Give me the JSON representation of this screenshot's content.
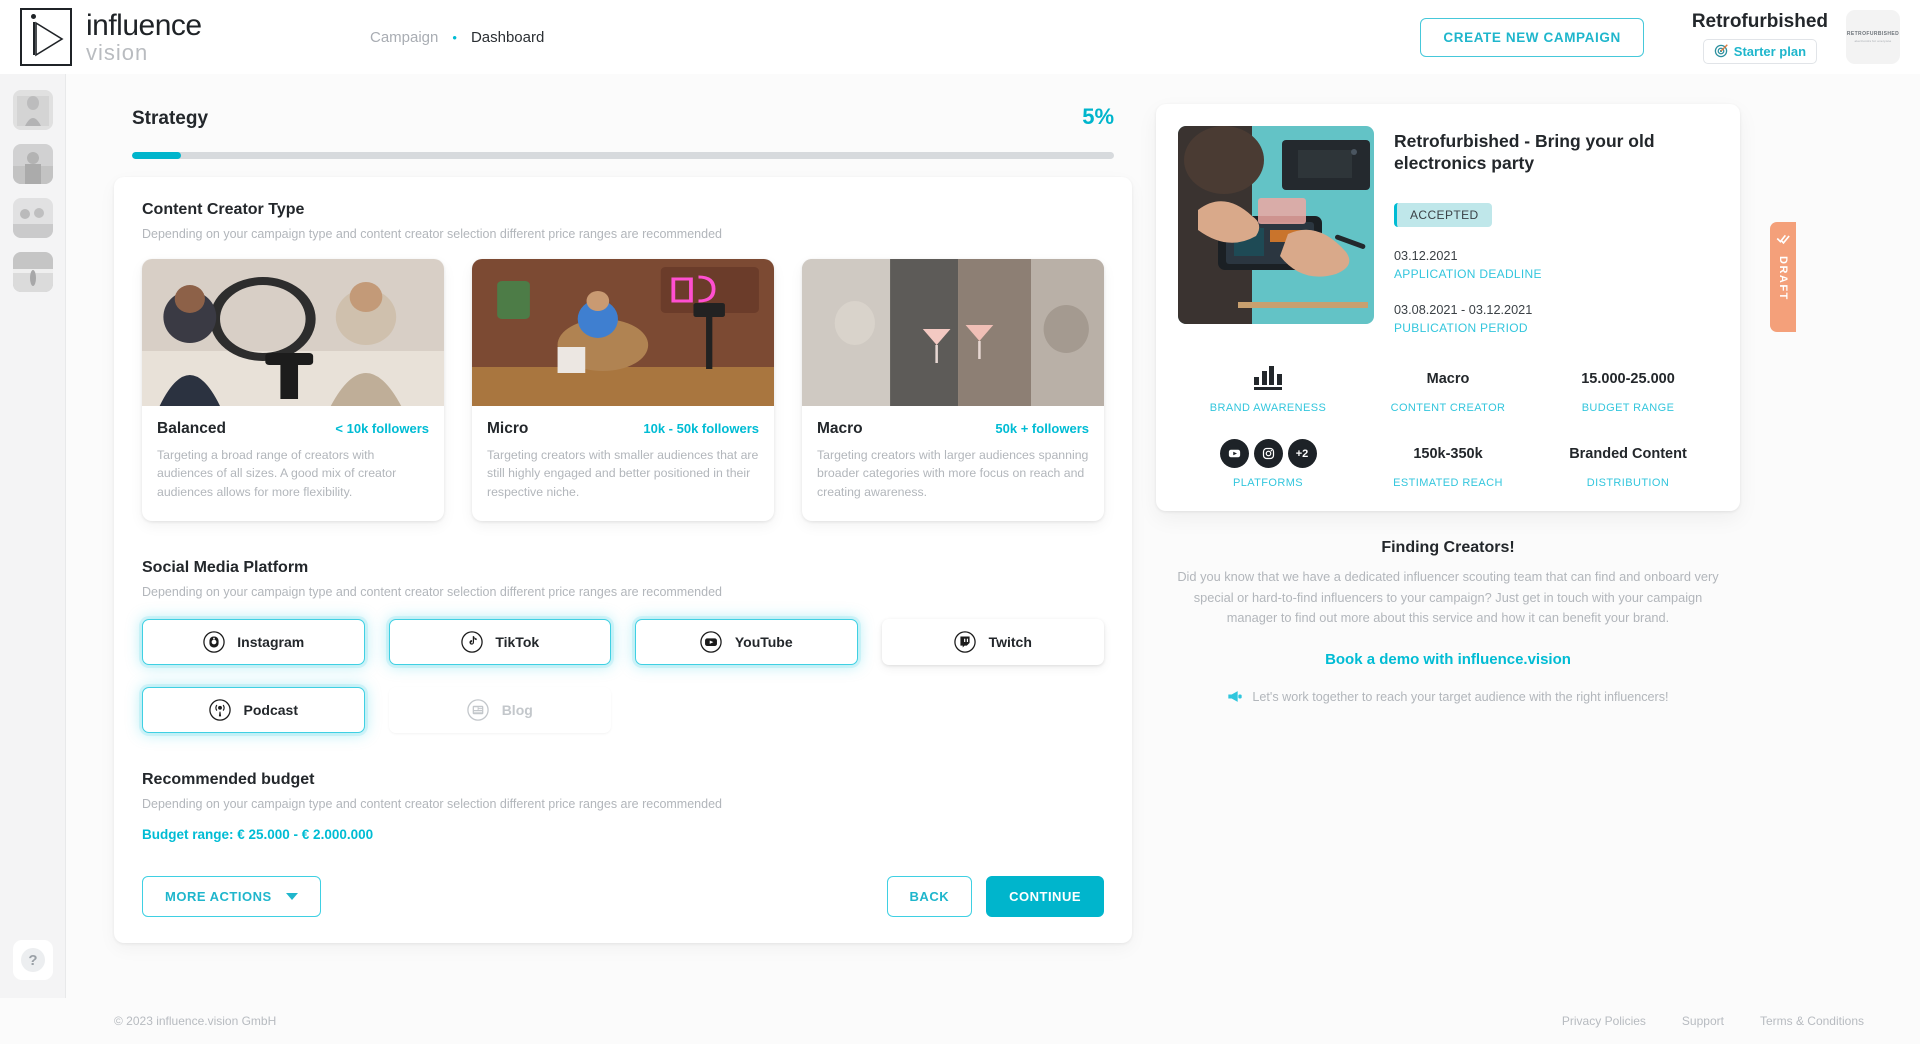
{
  "brand": {
    "line1": "influence",
    "line2": "vision"
  },
  "breadcrumb": {
    "parent": "Campaign",
    "separator": "•",
    "current": "Dashboard"
  },
  "header": {
    "create_button": "CREATE NEW CAMPAIGN",
    "account_name": "Retrofurbished",
    "plan_label": "Starter plan",
    "plan_icon": "target-icon",
    "avatar_line1": "RETROFURBISHED",
    "avatar_line2": "electronics for everyone"
  },
  "strategy": {
    "title": "Strategy",
    "percent_label": "5%",
    "percent_value": 5
  },
  "content_creator": {
    "title": "Content Creator Type",
    "subtitle": "Depending on your campaign type and content creator selection different price ranges are recommended",
    "cards": [
      {
        "name": "Balanced",
        "range": "< 10k followers",
        "description": "Targeting a broad range of creators with audiences of all sizes. A good mix of creator audiences allows for more flexibility.",
        "image": "two-women-podcast-ring-light",
        "selected": true
      },
      {
        "name": "Micro",
        "range": "10k - 50k followers",
        "description": "Targeting creators with smaller audiences that are still highly engaged and better positioned in their respective niche.",
        "image": "woman-on-couch-filming-neon-sign",
        "selected": false
      },
      {
        "name": "Macro",
        "range": "50k + followers",
        "description": "Targeting creators with larger audiences spanning broader categories with more focus on reach and creating awareness.",
        "image": "women-toasting-cocktails-sequin-dresses",
        "selected": false
      }
    ]
  },
  "social_media": {
    "title": "Social Media Platform",
    "subtitle": "Depending on your campaign type and content creator selection different price ranges are recommended",
    "platforms": [
      {
        "label": "Instagram",
        "icon": "instagram-icon",
        "state": "selected"
      },
      {
        "label": "TikTok",
        "icon": "tiktok-icon",
        "state": "selected"
      },
      {
        "label": "YouTube",
        "icon": "youtube-icon",
        "state": "selected"
      },
      {
        "label": "Twitch",
        "icon": "twitch-icon",
        "state": "default"
      },
      {
        "label": "Podcast",
        "icon": "podcast-icon",
        "state": "selected"
      },
      {
        "label": "Blog",
        "icon": "blog-icon",
        "state": "disabled"
      }
    ]
  },
  "budget": {
    "title": "Recommended budget",
    "subtitle": "Depending on your campaign type and content creator selection different price ranges are recommended",
    "range_line": "Budget range: € 25.000 - € 2.000.000"
  },
  "form_actions": {
    "more_actions": "MORE ACTIONS",
    "back": "BACK",
    "continue": "CONTINUE"
  },
  "campaign_card": {
    "title": "Retrofurbished - Bring your old electronics party",
    "status": "ACCEPTED",
    "draft_tab": "DRAFT",
    "thumbnail": "hands-repairing-smartphone-on-teal-desk",
    "deadline_value": "03.12.2021",
    "deadline_label": "APPLICATION DEADLINE",
    "publication_value": "03.08.2021 - 03.12.2021",
    "publication_label": "PUBLICATION PERIOD",
    "stats": [
      {
        "value": "",
        "icon": "bar-chart-icon",
        "label": "BRAND AWARENESS"
      },
      {
        "value": "Macro",
        "icon": "",
        "label": "CONTENT CREATOR"
      },
      {
        "value": "15.000-25.000",
        "icon": "",
        "label": "BUDGET RANGE"
      },
      {
        "value": "",
        "icon": "platform-dots",
        "label": "PLATFORMS",
        "extra": "+2"
      },
      {
        "value": "150k-350k",
        "icon": "",
        "label": "ESTIMATED REACH"
      },
      {
        "value": "Branded Content",
        "icon": "",
        "label": "DISTRIBUTION"
      }
    ]
  },
  "finding_creators": {
    "title": "Finding Creators!",
    "body": "Did you know that we have a dedicated influencer scouting team that can find and onboard very special or hard-to-find influencers to your campaign? Just get in touch with your campaign manager to find out more about this service and how it can benefit your brand.",
    "cta": "Book a demo with influence.vision",
    "tagline": "Let's work together to reach your target audience with the right influencers!",
    "tagline_icon": "megaphone-icon"
  },
  "footer": {
    "copyright": "© 2023 influence.vision GmbH",
    "links": [
      "Privacy Policies",
      "Support",
      "Terms & Conditions"
    ]
  },
  "colors": {
    "accent": "#00bcd4",
    "accent_dark": "#00b5cc",
    "draft": "#f4a07a",
    "badge_bg": "#bfe7ea",
    "muted": "#b2b6bb"
  }
}
